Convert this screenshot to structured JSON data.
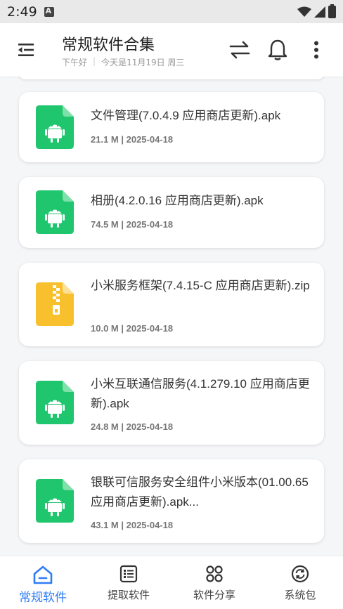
{
  "status_bar": {
    "time": "2:49"
  },
  "header": {
    "title": "常规软件合集",
    "greeting": "下午好",
    "date_text": "今天是11月19日 周三"
  },
  "files": [
    {
      "name": "文件管理(7.0.4.9 应用商店更新).apk",
      "meta": "21.1 M | 2025-04-18",
      "icon": "apk-android-icon"
    },
    {
      "name": "相册(4.2.0.16 应用商店更新).apk",
      "meta": "74.5 M | 2025-04-18",
      "icon": "apk-android-icon"
    },
    {
      "name": "小米服务框架(7.4.15-C 应用商店更新).zip",
      "meta": "10.0 M | 2025-04-18",
      "icon": "zip-archive-icon"
    },
    {
      "name": "小米互联通信服务(4.1.279.10 应用商店更新).apk",
      "meta": "24.8 M | 2025-04-18",
      "icon": "apk-android-icon"
    },
    {
      "name": "银联可信服务安全组件小米版本(01.00.65 应用商店更新).apk...",
      "meta": "43.1 M | 2025-04-18",
      "icon": "apk-android-icon"
    }
  ],
  "bottom_nav": [
    {
      "label": "常规软件",
      "icon": "home-icon",
      "active": true
    },
    {
      "label": "提取软件",
      "icon": "list-icon",
      "active": false
    },
    {
      "label": "软件分享",
      "icon": "grid-icon",
      "active": false
    },
    {
      "label": "系统包",
      "icon": "sync-icon",
      "active": false
    }
  ],
  "colors": {
    "accent": "#2f7df6",
    "apk_green": "#1fc66e",
    "zip_yellow": "#f9c02e"
  }
}
